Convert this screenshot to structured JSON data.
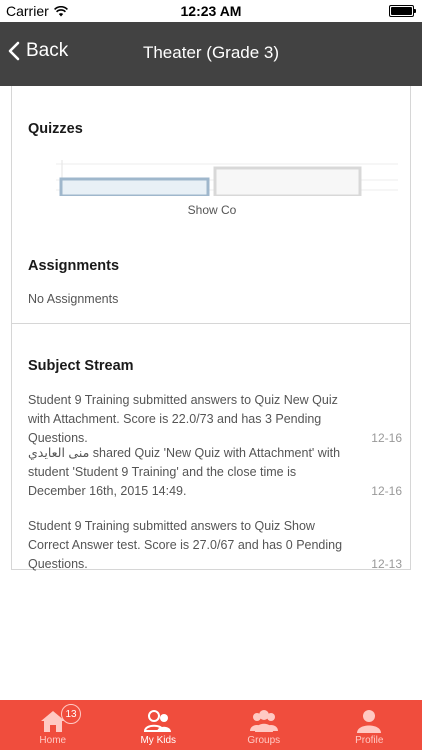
{
  "status_bar": {
    "carrier": "Carrier",
    "time": "12:23 AM"
  },
  "nav": {
    "back_label": "Back",
    "title": "Theater (Grade 3)"
  },
  "quizzes": {
    "title": "Quizzes",
    "chart_data": {
      "type": "bar",
      "categories": [
        "Show Co"
      ],
      "visible_label": "Show Co"
    }
  },
  "assignments": {
    "title": "Assignments",
    "empty_text": "No Assignments"
  },
  "stream": {
    "title": "Subject Stream",
    "items": [
      {
        "text": "Student 9 Training submitted answers to Quiz New Quiz with Attachment. Score is 22.0/73 and has 3 Pending Questions.",
        "date": "12-16"
      },
      {
        "text": "منى العايدي shared Quiz 'New Quiz with Attachment' with student 'Student 9 Training' and the close time is December 16th, 2015 14:49.",
        "date": "12-16"
      },
      {
        "text": "Student 9 Training submitted answers to Quiz Show Correct Answer test. Score is 27.0/67 and has 0 Pending Questions.",
        "date": "12-13"
      }
    ]
  },
  "tabs": [
    {
      "label": "Home",
      "icon": "home-icon",
      "badge": "13"
    },
    {
      "label": "My Kids",
      "icon": "kids-icon"
    },
    {
      "label": "Groups",
      "icon": "groups-icon"
    },
    {
      "label": "Profile",
      "icon": "profile-icon"
    }
  ],
  "colors": {
    "nav_bg": "#424242",
    "tab_bg": "#f04d3d",
    "tab_inactive": "#ffc9c3"
  }
}
